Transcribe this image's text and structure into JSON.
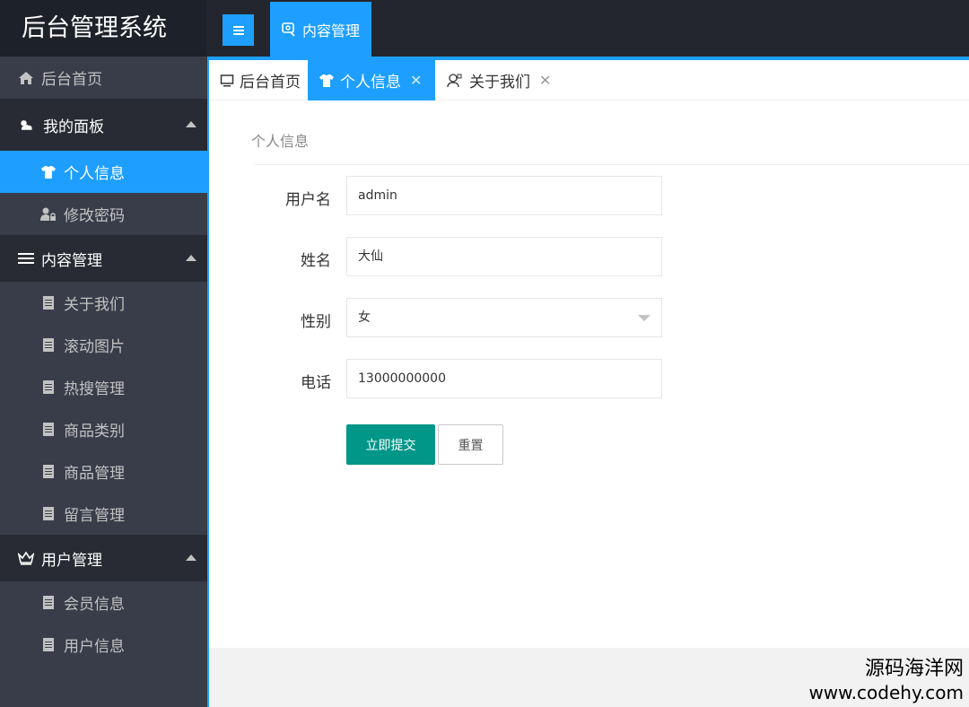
{
  "app": {
    "title": "后台管理系统"
  },
  "header": {
    "menu_toggle_icon": "hamburger-icon",
    "top_tab_label": "内容管理",
    "top_tab_icon": "map-pin-icon"
  },
  "sidebar": {
    "items": [
      {
        "label": "后台首页",
        "icon": "home-icon"
      },
      {
        "label": "我的面板",
        "icon": "cloud-sun-icon"
      },
      {
        "label": "个人信息",
        "icon": "shirt-icon"
      },
      {
        "label": "修改密码",
        "icon": "user-lock-icon"
      },
      {
        "label": "内容管理",
        "icon": "list-icon"
      },
      {
        "label": "关于我们",
        "icon": "document-icon"
      },
      {
        "label": "滚动图片",
        "icon": "document-icon"
      },
      {
        "label": "热搜管理",
        "icon": "document-icon"
      },
      {
        "label": "商品类别",
        "icon": "document-icon"
      },
      {
        "label": "商品管理",
        "icon": "document-icon"
      },
      {
        "label": "留言管理",
        "icon": "document-icon"
      },
      {
        "label": "用户管理",
        "icon": "crown-icon"
      },
      {
        "label": "会员信息",
        "icon": "document-icon"
      },
      {
        "label": "用户信息",
        "icon": "document-icon"
      }
    ]
  },
  "tabs": [
    {
      "label": "后台首页",
      "icon": "monitor-icon"
    },
    {
      "label": "个人信息",
      "icon": "shirt-icon",
      "close": "✕"
    },
    {
      "label": "关于我们",
      "icon": "user-icon",
      "close": "✕"
    }
  ],
  "form": {
    "section_title": "个人信息",
    "username_label": "用户名",
    "username_value": "admin",
    "name_label": "姓名",
    "name_value": "大仙",
    "gender_label": "性别",
    "gender_value": "女",
    "phone_label": "电话",
    "phone_value": "13000000000",
    "submit_label": "立即提交",
    "reset_label": "重置"
  },
  "watermark": {
    "line1": "源码海洋网",
    "line2": "www.codehy.com"
  },
  "colors": {
    "accent": "#1e9fff",
    "sidebar_bg": "#393d49",
    "header_bg": "#23262e",
    "submit_bg": "#009688"
  }
}
